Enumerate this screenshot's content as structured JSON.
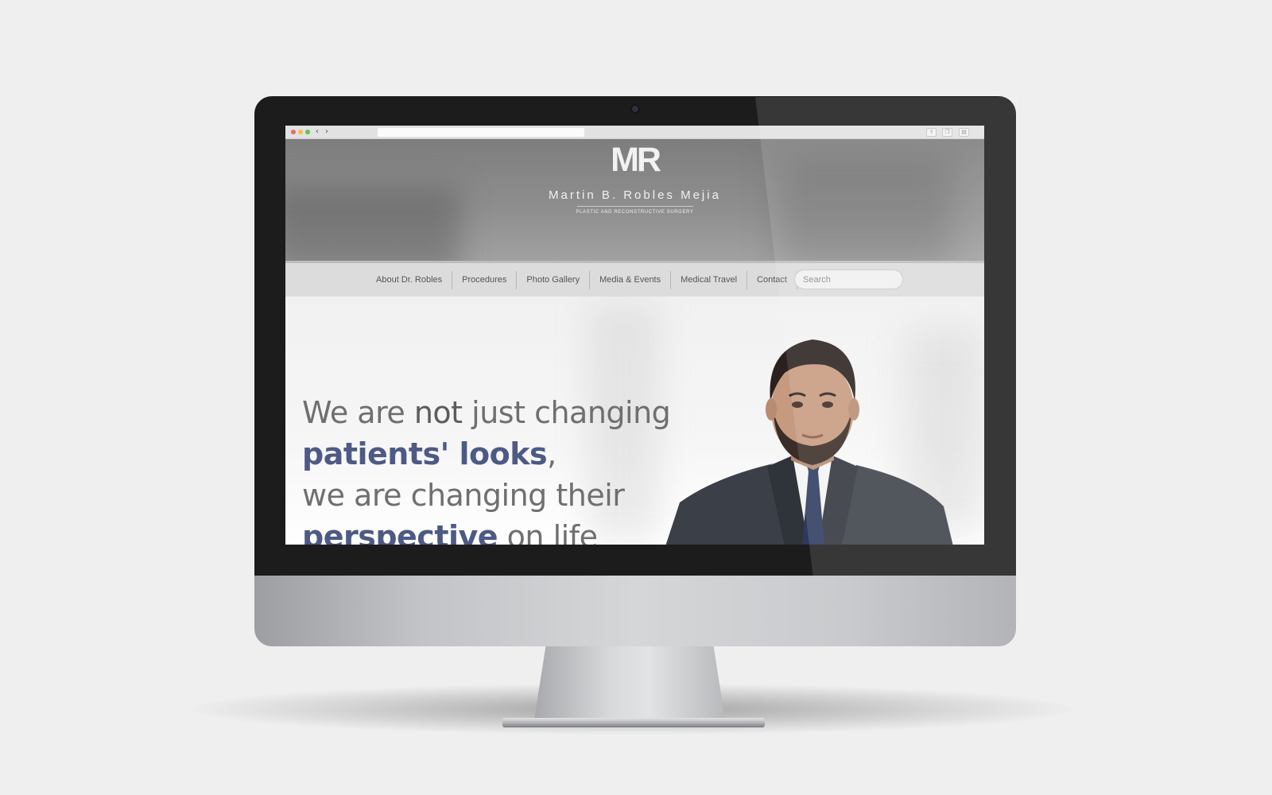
{
  "site": {
    "logo_mark": "MR",
    "name": "Martin B. Robles Mejia",
    "tagline": "PLASTIC AND RECONSTRUCTIVE SURGERY"
  },
  "nav": {
    "items": [
      {
        "label": "About Dr. Robles"
      },
      {
        "label": "Procedures"
      },
      {
        "label": "Photo Gallery"
      },
      {
        "label": "Media & Events"
      },
      {
        "label": "Medical Travel"
      },
      {
        "label": "Contact"
      }
    ],
    "search_placeholder": "Search"
  },
  "hero": {
    "line1_a": "We are ",
    "line1_b": "not",
    "line1_c": " just changing",
    "line2_a": "patients' looks",
    "line2_b": ",",
    "line3": "we are changing their",
    "line4_a": "perspective",
    "line4_b": " on life"
  },
  "colors": {
    "accent": "#4d5a85",
    "text": "#6f6f6f",
    "header_bg": "#8a8a8a",
    "nav_bg": "#dcdcdc"
  }
}
